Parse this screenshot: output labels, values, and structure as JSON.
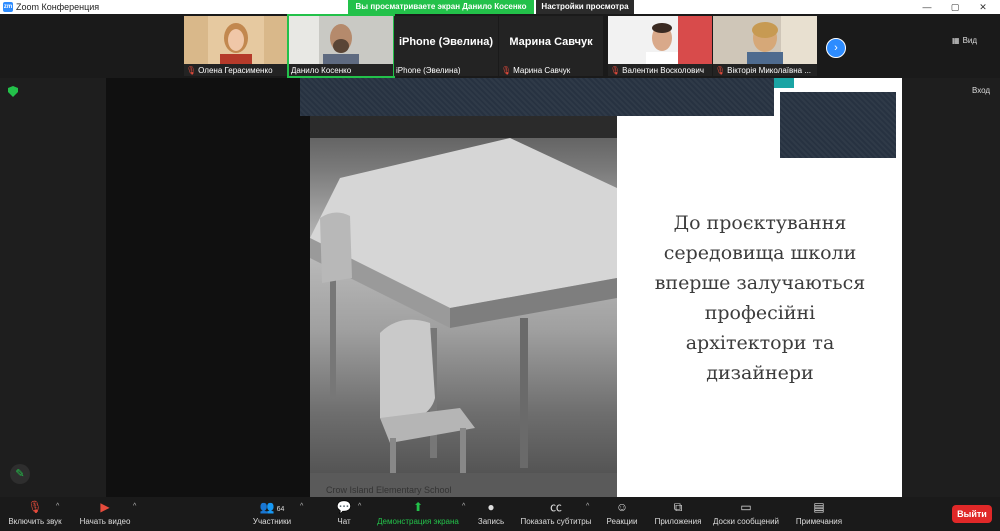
{
  "window": {
    "title": "Zoom Конференция",
    "app_icon": "zm"
  },
  "banner": {
    "share_text": "Вы просматриваете экран Данило Косенко",
    "view_settings": "Настройки просмотра"
  },
  "window_controls": {
    "minimize": "—",
    "restore": "▢",
    "close": "✕"
  },
  "participants": [
    {
      "name": "Олена Герасименко",
      "muted": true,
      "has_video": true
    },
    {
      "name": "Данило Косенко",
      "muted": false,
      "has_video": true,
      "active": true
    },
    {
      "name": "iPhone (Эвелина)",
      "muted": false,
      "has_video": false,
      "big_label": "iPhone (Эвелина)"
    },
    {
      "name": "Марина Савчук",
      "muted": true,
      "has_video": false,
      "big_label": "Марина Савчук"
    },
    {
      "name": "Валентин Восколович",
      "muted": true,
      "has_video": true
    },
    {
      "name": "Вікторія Миколаївна ...",
      "muted": true,
      "has_video": true
    }
  ],
  "strip_controls": {
    "next": "›",
    "view_label": "Вид"
  },
  "stage": {
    "enter_label": "Вход"
  },
  "slide": {
    "photo_caption": "Crow Island Elementary School",
    "lines": [
      "До проєктування",
      "середовища школи",
      "вперше залучаються",
      "професійні",
      "архітектори та",
      "дизайнери"
    ]
  },
  "toolbar": {
    "audio": "Включить звук",
    "video": "Начать видео",
    "participants": "Участники",
    "participants_count": "64",
    "chat": "Чат",
    "share": "Демонстрация экрана",
    "record": "Запись",
    "captions": "Показать субтитры",
    "reactions": "Реакции",
    "apps": "Приложения",
    "whiteboards": "Доски сообщений",
    "notes": "Примечания",
    "leave": "Выйти"
  },
  "colors": {
    "accent_green": "#23c14a",
    "accent_blue": "#2d8cff",
    "danger_red": "#e02828"
  }
}
